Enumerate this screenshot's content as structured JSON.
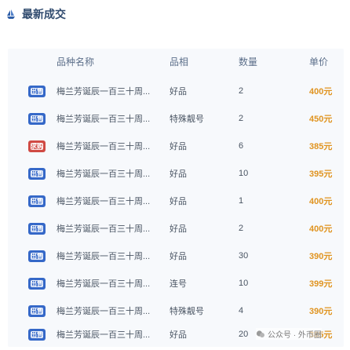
{
  "header": {
    "title": "最新成交",
    "icon": "ship-icon"
  },
  "columns": {
    "name": "品种名称",
    "quality": "品相",
    "quantity": "数量",
    "price": "单价"
  },
  "colors": {
    "sell_badge": "#3568c8",
    "buy_badge": "#d04a44",
    "price": "#e09420",
    "title": "#2f4a6e"
  },
  "rows": [
    {
      "badge": "出售",
      "type": "sell",
      "name": "梅兰芳诞辰一百三十周...",
      "quality": "好品",
      "quantity": "2",
      "price": "400元"
    },
    {
      "badge": "出售",
      "type": "sell",
      "name": "梅兰芳诞辰一百三十周...",
      "quality": "特殊靓号",
      "quantity": "2",
      "price": "450元"
    },
    {
      "badge": "求购",
      "type": "buy",
      "name": "梅兰芳诞辰一百三十周...",
      "quality": "好品",
      "quantity": "6",
      "price": "385元"
    },
    {
      "badge": "出售",
      "type": "sell",
      "name": "梅兰芳诞辰一百三十周...",
      "quality": "好品",
      "quantity": "10",
      "price": "395元"
    },
    {
      "badge": "出售",
      "type": "sell",
      "name": "梅兰芳诞辰一百三十周...",
      "quality": "好品",
      "quantity": "1",
      "price": "400元"
    },
    {
      "badge": "出售",
      "type": "sell",
      "name": "梅兰芳诞辰一百三十周...",
      "quality": "好品",
      "quantity": "2",
      "price": "400元"
    },
    {
      "badge": "出售",
      "type": "sell",
      "name": "梅兰芳诞辰一百三十周...",
      "quality": "好品",
      "quantity": "30",
      "price": "390元"
    },
    {
      "badge": "出售",
      "type": "sell",
      "name": "梅兰芳诞辰一百三十周...",
      "quality": "连号",
      "quantity": "10",
      "price": "399元"
    },
    {
      "badge": "出售",
      "type": "sell",
      "name": "梅兰芳诞辰一百三十周...",
      "quality": "特殊靓号",
      "quantity": "4",
      "price": "390元"
    },
    {
      "badge": "出售",
      "type": "sell",
      "name": "梅兰芳诞辰一百三十周...",
      "quality": "好品",
      "quantity": "20",
      "price": "385元"
    }
  ],
  "watermark": {
    "text": "公众号 · 外币圈"
  }
}
